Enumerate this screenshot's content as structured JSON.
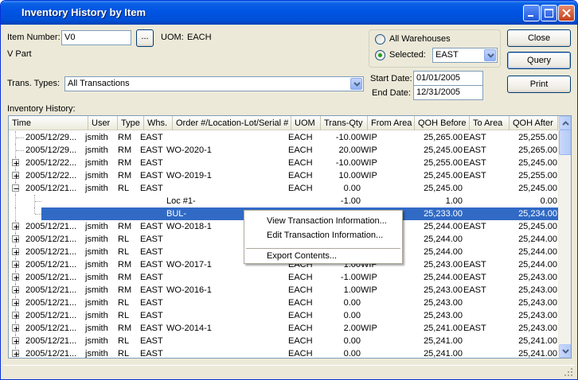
{
  "window": {
    "title": "Inventory History by Item"
  },
  "form": {
    "item_number_label": "Item Number:",
    "item_number_value": "V0",
    "lookup_button": "...",
    "uom_label": "UOM:",
    "uom_value": "EACH",
    "item_description": "V Part",
    "trans_types_label": "Trans. Types:",
    "trans_types_value": "All Transactions",
    "warehouse_all_label": "All Warehouses",
    "warehouse_selected_label": "Selected:",
    "warehouse_selected_value": "EAST",
    "start_date_label": "Start Date:",
    "start_date_value": "01/01/2005",
    "end_date_label": "End Date:",
    "end_date_value": "12/31/2005"
  },
  "buttons": {
    "close": "Close",
    "query": "Query",
    "print": "Print"
  },
  "history": {
    "label": "Inventory History:",
    "columns": [
      "Time",
      "User",
      "Type",
      "Whs.",
      "Order #/Location-Lot/Serial #",
      "UOM",
      "Trans-Qty",
      "From Area",
      "QOH Before",
      "To Area",
      "QOH After"
    ],
    "rows": [
      {
        "time": "2005/12/29...",
        "user": "jsmith",
        "type": "RM",
        "whs": "EAST",
        "order": "",
        "uom": "EACH",
        "qty": "-10.00",
        "from": "WIP",
        "before": "25,265.00",
        "to": "EAST",
        "after": "25,255.00",
        "expander": "none"
      },
      {
        "time": "2005/12/29...",
        "user": "jsmith",
        "type": "RM",
        "whs": "EAST",
        "order": "WO-2020-1",
        "uom": "EACH",
        "qty": "20.00",
        "from": "WIP",
        "before": "25,245.00",
        "to": "EAST",
        "after": "25,265.00",
        "expander": "none"
      },
      {
        "time": "2005/12/22...",
        "user": "jsmith",
        "type": "RM",
        "whs": "EAST",
        "order": "",
        "uom": "EACH",
        "qty": "-10.00",
        "from": "WIP",
        "before": "25,255.00",
        "to": "EAST",
        "after": "25,245.00",
        "expander": "plus"
      },
      {
        "time": "2005/12/22...",
        "user": "jsmith",
        "type": "RM",
        "whs": "EAST",
        "order": "WO-2019-1",
        "uom": "EACH",
        "qty": "10.00",
        "from": "WIP",
        "before": "25,245.00",
        "to": "EAST",
        "after": "25,255.00",
        "expander": "plus"
      },
      {
        "time": "2005/12/21...",
        "user": "jsmith",
        "type": "RL",
        "whs": "EAST",
        "order": "",
        "uom": "EACH",
        "qty": "0.00",
        "from": "",
        "before": "25,245.00",
        "to": "",
        "after": "25,245.00",
        "expander": "minus"
      },
      {
        "time": "",
        "user": "",
        "type": "",
        "whs": "",
        "order": "Loc #1-",
        "uom": "",
        "qty": "-1.00",
        "from": "",
        "before": "1.00",
        "to": "",
        "after": "0.00",
        "expander": "child"
      },
      {
        "time": "",
        "user": "",
        "type": "",
        "whs": "",
        "order": "BUL-",
        "uom": "",
        "qty": "1.00",
        "from": "",
        "before": "25,233.00",
        "to": "",
        "after": "25,234.00",
        "expander": "child-last",
        "selected": true
      },
      {
        "time": "2005/12/21...",
        "user": "jsmith",
        "type": "RM",
        "whs": "EAST",
        "order": "WO-2018-1",
        "uom": "",
        "qty": "",
        "from": "",
        "before": "25,244.00",
        "to": "EAST",
        "after": "25,245.00",
        "expander": "plus"
      },
      {
        "time": "2005/12/21...",
        "user": "jsmith",
        "type": "RL",
        "whs": "EAST",
        "order": "",
        "uom": "",
        "qty": "",
        "from": "",
        "before": "25,244.00",
        "to": "",
        "after": "25,244.00",
        "expander": "plus"
      },
      {
        "time": "2005/12/21...",
        "user": "jsmith",
        "type": "RL",
        "whs": "EAST",
        "order": "",
        "uom": "",
        "qty": "",
        "from": "",
        "before": "25,244.00",
        "to": "",
        "after": "25,244.00",
        "expander": "plus"
      },
      {
        "time": "2005/12/21...",
        "user": "jsmith",
        "type": "RM",
        "whs": "EAST",
        "order": "WO-2017-1",
        "uom": "EACH",
        "qty": "1.00",
        "from": "WIP",
        "before": "25,243.00",
        "to": "EAST",
        "after": "25,244.00",
        "expander": "plus"
      },
      {
        "time": "2005/12/21...",
        "user": "jsmith",
        "type": "RM",
        "whs": "EAST",
        "order": "",
        "uom": "EACH",
        "qty": "-1.00",
        "from": "WIP",
        "before": "25,244.00",
        "to": "EAST",
        "after": "25,243.00",
        "expander": "plus"
      },
      {
        "time": "2005/12/21...",
        "user": "jsmith",
        "type": "RM",
        "whs": "EAST",
        "order": "WO-2016-1",
        "uom": "EACH",
        "qty": "1.00",
        "from": "WIP",
        "before": "25,243.00",
        "to": "EAST",
        "after": "25,243.00",
        "expander": "plus"
      },
      {
        "time": "2005/12/21...",
        "user": "jsmith",
        "type": "RL",
        "whs": "EAST",
        "order": "",
        "uom": "EACH",
        "qty": "0.00",
        "from": "",
        "before": "25,243.00",
        "to": "",
        "after": "25,243.00",
        "expander": "plus"
      },
      {
        "time": "2005/12/21...",
        "user": "jsmith",
        "type": "RL",
        "whs": "EAST",
        "order": "",
        "uom": "EACH",
        "qty": "0.00",
        "from": "",
        "before": "25,243.00",
        "to": "",
        "after": "25,243.00",
        "expander": "plus"
      },
      {
        "time": "2005/12/21...",
        "user": "jsmith",
        "type": "RM",
        "whs": "EAST",
        "order": "WO-2014-1",
        "uom": "EACH",
        "qty": "2.00",
        "from": "WIP",
        "before": "25,241.00",
        "to": "EAST",
        "after": "25,243.00",
        "expander": "plus"
      },
      {
        "time": "2005/12/21...",
        "user": "jsmith",
        "type": "RL",
        "whs": "EAST",
        "order": "",
        "uom": "EACH",
        "qty": "0.00",
        "from": "",
        "before": "25,241.00",
        "to": "",
        "after": "25,241.00",
        "expander": "plus"
      },
      {
        "time": "2005/12/21...",
        "user": "jsmith",
        "type": "RL",
        "whs": "EAST",
        "order": "",
        "uom": "EACH",
        "qty": "0.00",
        "from": "",
        "before": "25,241.00",
        "to": "",
        "after": "25,241.00",
        "expander": "plus"
      }
    ]
  },
  "context_menu": {
    "items": [
      "View Transaction Information...",
      "Edit Transaction Information...",
      "Export Contents..."
    ]
  },
  "colors": {
    "title_bar": "#0054e3",
    "selection": "#316ac5",
    "window_bg": "#ece9d8"
  }
}
